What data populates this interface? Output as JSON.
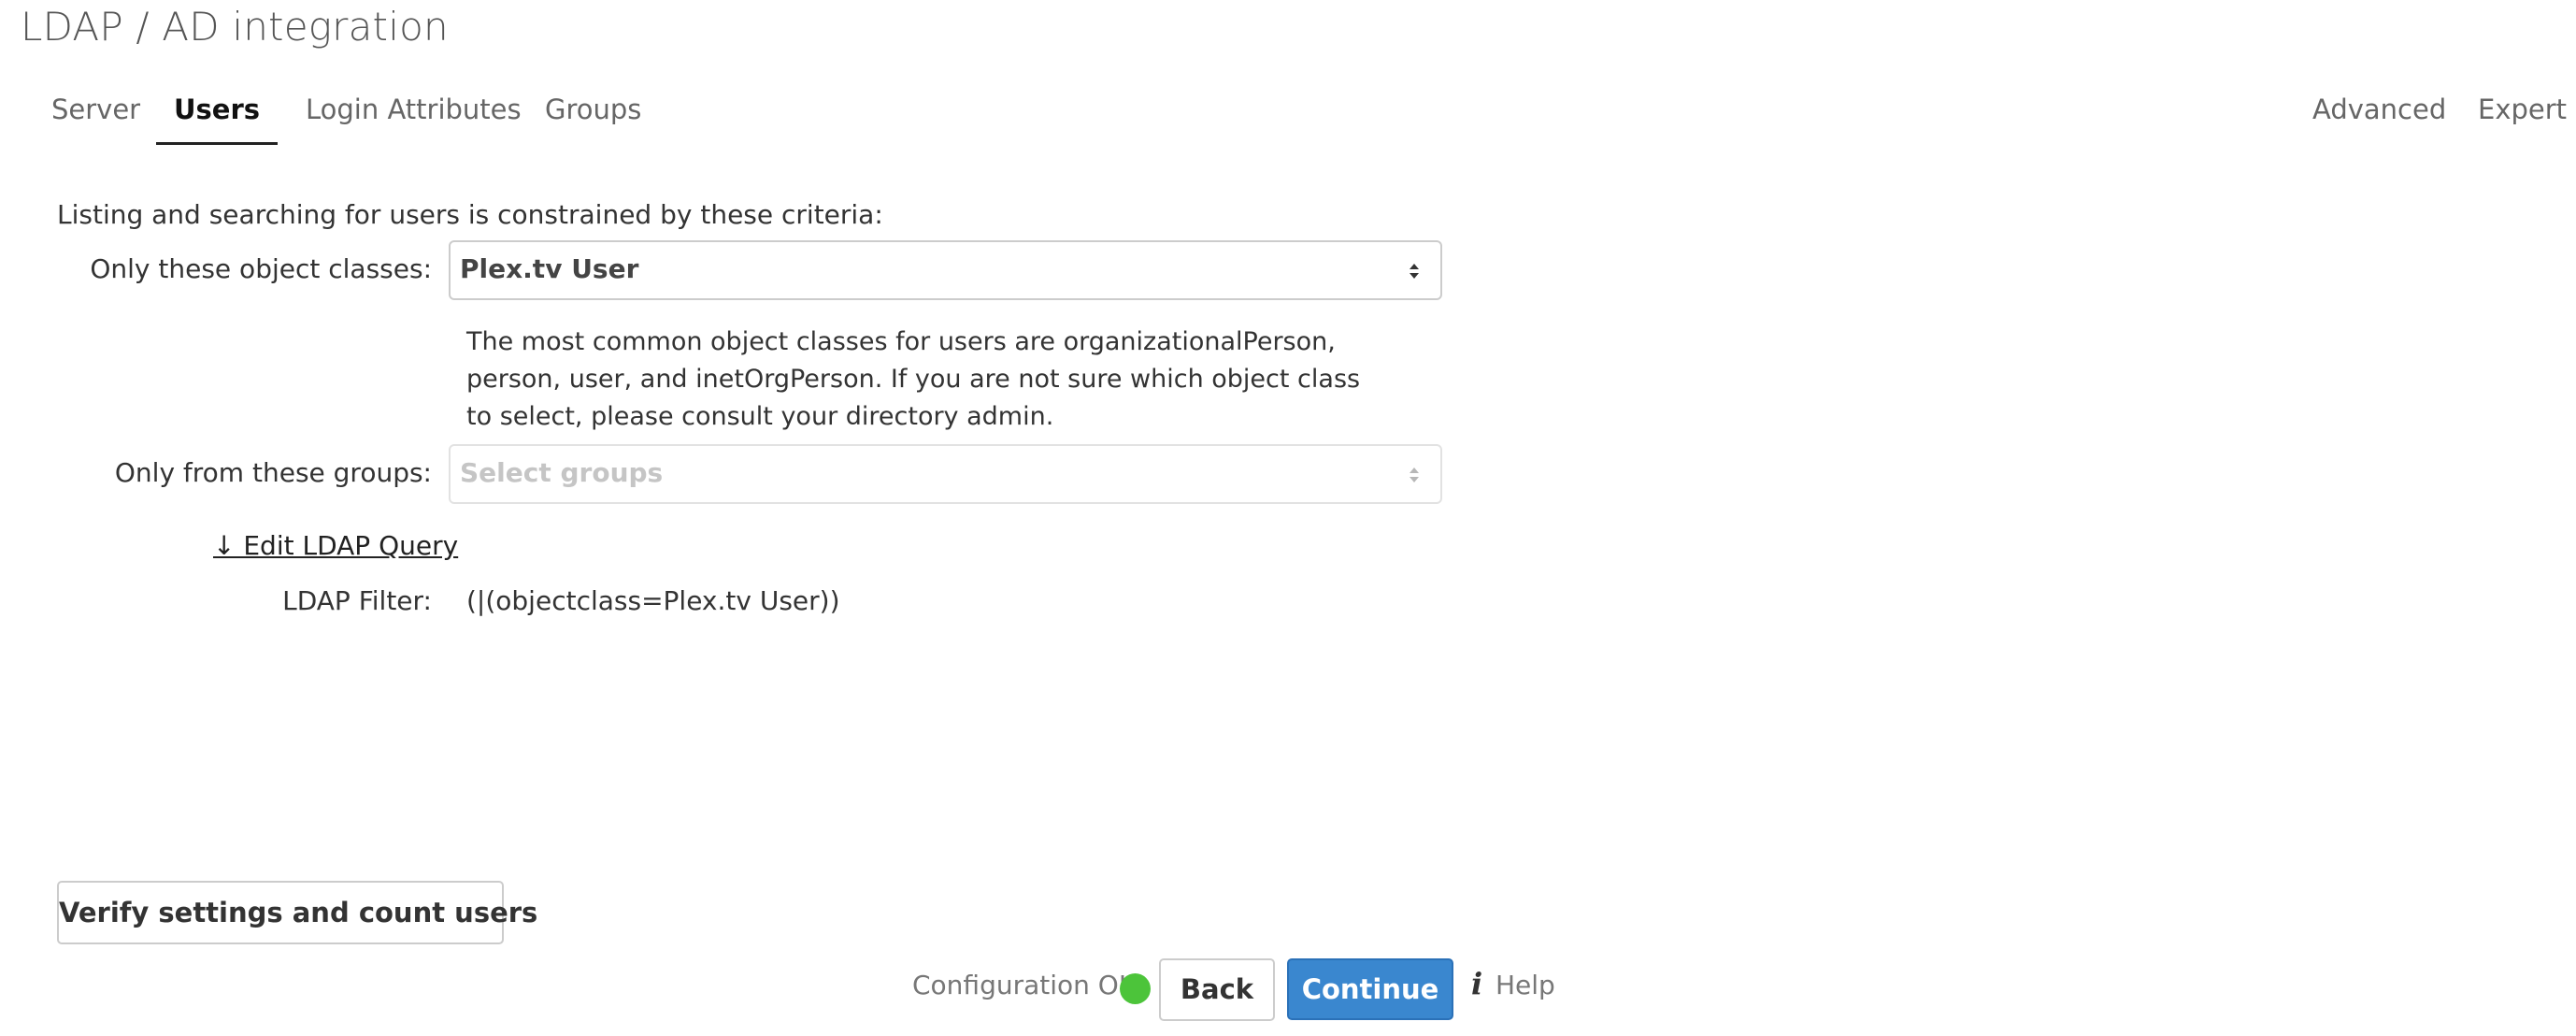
{
  "page": {
    "title": "LDAP / AD integration"
  },
  "tabs": {
    "left": [
      {
        "label": "Server",
        "active": false
      },
      {
        "label": "Users",
        "active": true
      },
      {
        "label": "Login Attributes",
        "active": false
      },
      {
        "label": "Groups",
        "active": false
      }
    ],
    "right": [
      {
        "label": "Advanced"
      },
      {
        "label": "Expert"
      }
    ]
  },
  "users_form": {
    "criteria_text": "Listing and searching for users is constrained by these criteria:",
    "object_classes": {
      "label": "Only these object classes:",
      "value": "Plex.tv User",
      "help_text": "The most common object classes for users are organizationalPerson, person, user, and inetOrgPerson. If you are not sure which object class to select, please consult your directory admin."
    },
    "groups": {
      "label": "Only from these groups:",
      "placeholder": "Select groups"
    },
    "edit_query_link": "↓ Edit LDAP Query",
    "filter": {
      "label": "LDAP Filter:",
      "value": "(|(objectclass=Plex.tv User))"
    }
  },
  "footer": {
    "verify_button": "Verify settings and count users",
    "status_text": "Configuration OK",
    "status_color": "#4cc43a",
    "back_button": "Back",
    "continue_button": "Continue",
    "help_icon": "info-icon",
    "help_label": "Help"
  },
  "colors": {
    "primary": "#3a87cf",
    "status_ok": "#4cc43a"
  }
}
